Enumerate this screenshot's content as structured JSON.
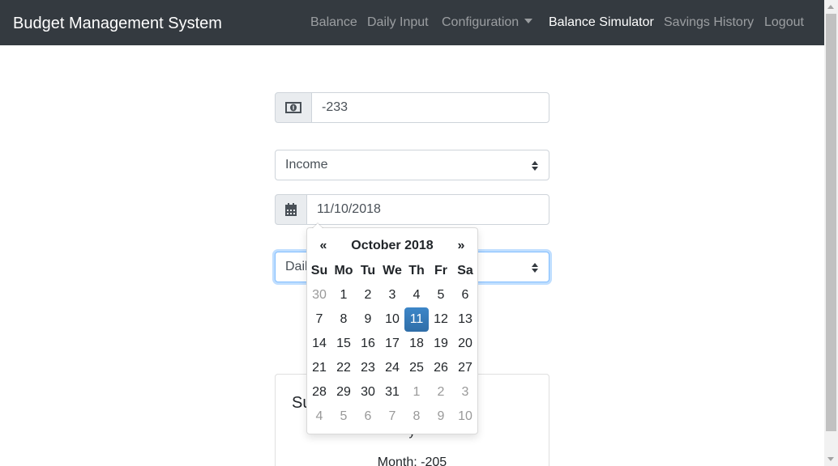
{
  "navbar": {
    "brand": "Budget Management System",
    "items": [
      {
        "label": "Balance"
      },
      {
        "label": "Daily Input"
      },
      {
        "label": "Configuration"
      },
      {
        "label": "Balance Simulator"
      },
      {
        "label": "Savings History"
      },
      {
        "label": "Logout"
      }
    ]
  },
  "form": {
    "amount_value": "-233",
    "amount_icon": "money-bill-icon",
    "type_value": "Income",
    "date_value": "11/10/2018",
    "date_icon": "calendar-icon",
    "period_value": "Daily"
  },
  "datepicker": {
    "prev": "«",
    "next": "»",
    "title": "October 2018",
    "weekdays": [
      "Su",
      "Mo",
      "Tu",
      "We",
      "Th",
      "Fr",
      "Sa"
    ],
    "weeks": [
      [
        "30",
        "1",
        "2",
        "3",
        "4",
        "5",
        "6"
      ],
      [
        "7",
        "8",
        "9",
        "10",
        "11",
        "12",
        "13"
      ],
      [
        "14",
        "15",
        "16",
        "17",
        "18",
        "19",
        "20"
      ],
      [
        "21",
        "22",
        "23",
        "24",
        "25",
        "26",
        "27"
      ],
      [
        "28",
        "29",
        "30",
        "31",
        "1",
        "2",
        "3"
      ],
      [
        "4",
        "5",
        "6",
        "7",
        "8",
        "9",
        "10"
      ]
    ],
    "selected": "11"
  },
  "summary": {
    "title_visible": "Su",
    "line1_visible": "y",
    "line2": "Month: -205"
  },
  "colors": {
    "navbar_bg": "#343a40",
    "selected_day": "#337ab7",
    "focus_border": "#80bdff"
  }
}
